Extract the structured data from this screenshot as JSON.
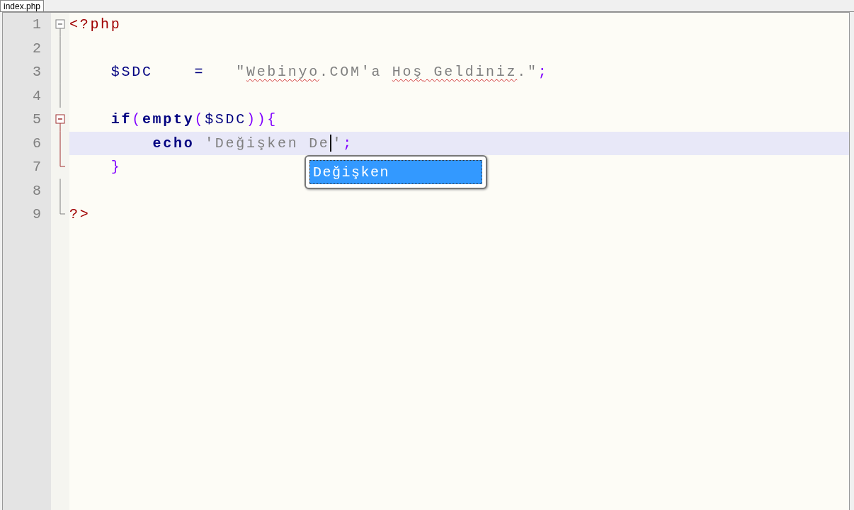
{
  "tabs": [
    {
      "label": "index.php",
      "selected": true
    }
  ],
  "lines": [
    {
      "number": "1",
      "kind": "open",
      "active": false,
      "current": false,
      "tokens": [
        {
          "kind": "tag",
          "text": "<?php"
        }
      ]
    },
    {
      "number": "2",
      "kind": "body",
      "active": false,
      "current": false
    },
    {
      "number": "3",
      "kind": "body",
      "active": false,
      "current": false,
      "tokens": [
        {
          "kind": "variable",
          "text": "    $SDC"
        },
        {
          "kind": "operator",
          "text": "    ="
        },
        {
          "kind": "string",
          "text": "   \""
        },
        {
          "kind": "string",
          "text": "Webinyo",
          "misspelled": true
        },
        {
          "kind": "string",
          "text": ".COM'a "
        },
        {
          "kind": "string",
          "text": "Hoş",
          "misspelled": true
        },
        {
          "kind": "string",
          "text": " Geldiniz",
          "misspelled": true
        },
        {
          "kind": "string",
          "text": ".\""
        },
        {
          "kind": "punct",
          "text": ";"
        }
      ]
    },
    {
      "number": "4",
      "kind": "body",
      "active": false,
      "current": false
    },
    {
      "number": "5",
      "kind": "open",
      "active": true,
      "current": false,
      "tokens": [
        {
          "kind": "keyword",
          "text": "    if"
        },
        {
          "kind": "punct",
          "text": "("
        },
        {
          "kind": "keyword",
          "text": "empty"
        },
        {
          "kind": "punct",
          "text": "("
        },
        {
          "kind": "variable",
          "text": "$SDC"
        },
        {
          "kind": "punct",
          "text": ")){"
        }
      ]
    },
    {
      "number": "6",
      "kind": "body",
      "active": true,
      "current": true,
      "tokens": [
        {
          "kind": "keyword",
          "text": "        echo"
        },
        {
          "kind": "string",
          "text": " 'Değişken De"
        },
        {
          "kind": "caret"
        },
        {
          "kind": "string",
          "text": "'"
        },
        {
          "kind": "punct",
          "text": ";"
        }
      ]
    },
    {
      "number": "7",
      "kind": "end",
      "active": true,
      "current": false,
      "tokens": [
        {
          "kind": "punct",
          "text": "    }"
        }
      ]
    },
    {
      "number": "8",
      "kind": "body",
      "active": false,
      "current": false
    },
    {
      "number": "9",
      "kind": "end",
      "active": false,
      "current": false,
      "tokens": [
        {
          "kind": "tag",
          "text": "?>"
        }
      ]
    }
  ],
  "autocomplete": {
    "items": [
      {
        "label": "Değişken",
        "selected": true
      }
    ]
  }
}
